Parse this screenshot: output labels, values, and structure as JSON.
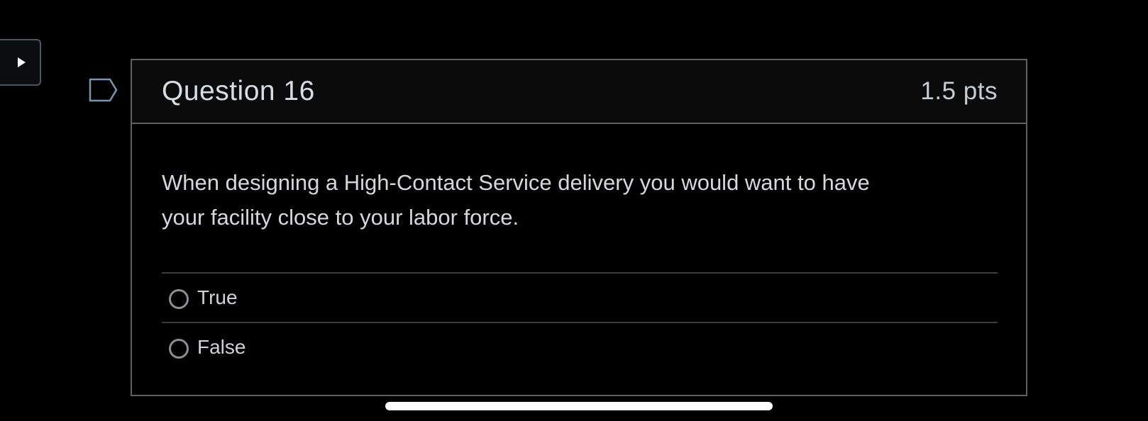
{
  "question": {
    "title": "Question 16",
    "points": "1.5 pts",
    "text": "When designing a High-Contact Service delivery you would want to have your facility close to your labor force.",
    "options": [
      {
        "label": "True",
        "selected": false
      },
      {
        "label": "False",
        "selected": false
      }
    ]
  },
  "icons": {
    "side_toggle": "play-icon",
    "flag": "flag-outline-icon"
  },
  "colors": {
    "background": "#000000",
    "header_background": "#0b0b0b",
    "border": "#5d6165",
    "text": "#d4d8dc",
    "flag_stroke": "#7a95b0"
  }
}
